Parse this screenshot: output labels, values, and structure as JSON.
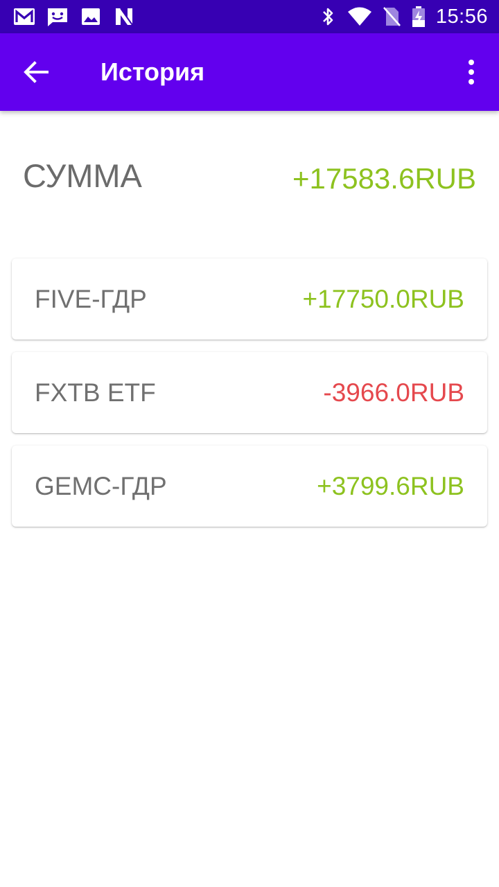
{
  "status_bar": {
    "time": "15:56",
    "left_icons": [
      "gmail-icon",
      "message-icon",
      "image-icon",
      "n-icon"
    ],
    "right_icons": [
      "bluetooth-icon",
      "wifi-icon",
      "no-sim-icon",
      "battery-charging-icon"
    ]
  },
  "app_bar": {
    "back_icon": "arrow-left-icon",
    "title": "История",
    "menu_icon": "more-vert-icon",
    "color": "#6200ee",
    "status_color": "#3700b3"
  },
  "summary": {
    "label": "СУММА",
    "value": "+17583.6RUB",
    "value_color": "#8dc21f"
  },
  "colors": {
    "positive": "#8dc21f",
    "negative": "#e5484d",
    "text_gray": "#707070"
  },
  "items": [
    {
      "name": "FIVE-ГДР",
      "value": "+17750.0RUB",
      "sign": "positive"
    },
    {
      "name": "FXTB ETF",
      "value": "-3966.0RUB",
      "sign": "negative"
    },
    {
      "name": "GEMC-ГДР",
      "value": "+3799.6RUB",
      "sign": "positive"
    }
  ]
}
